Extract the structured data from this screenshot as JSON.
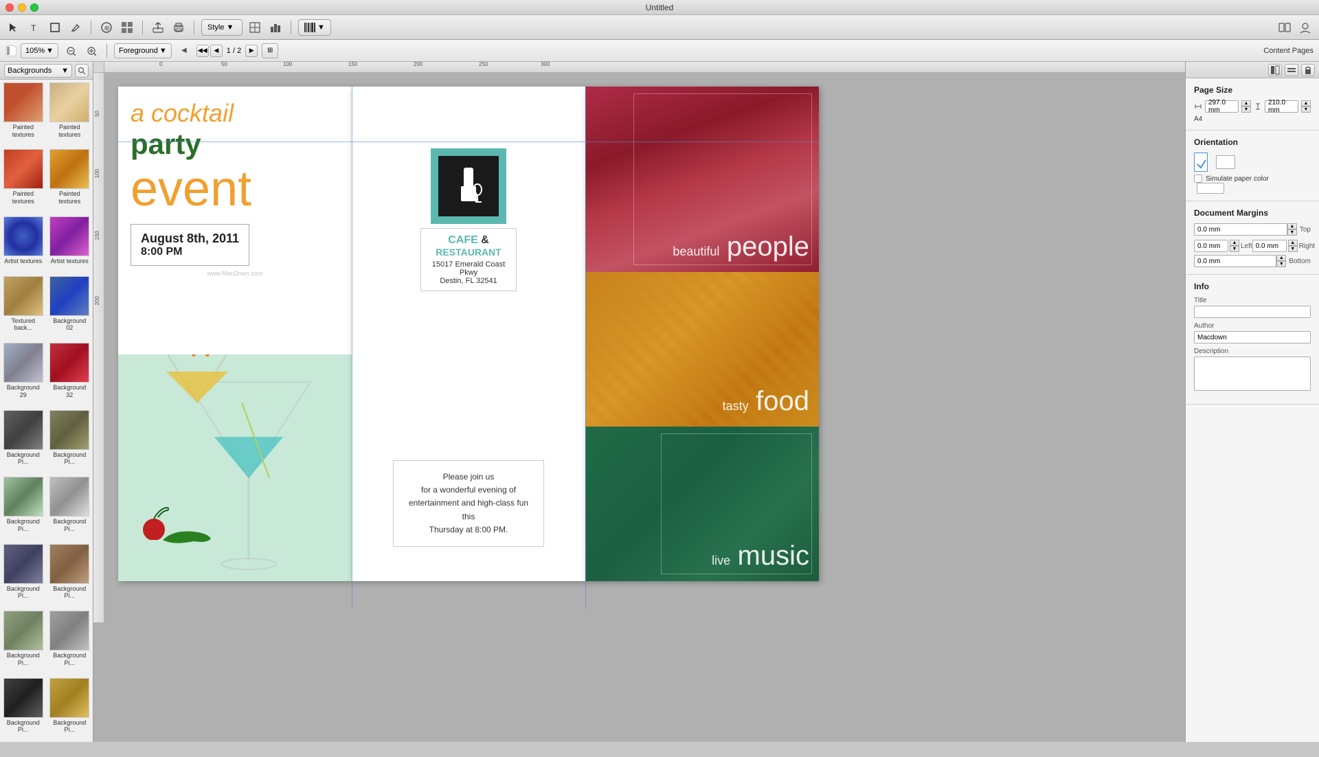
{
  "app": {
    "title": "Untitled",
    "window_controls": {
      "close": "●",
      "minimize": "●",
      "maximize": "●"
    }
  },
  "toolbar": {
    "style_label": "Style",
    "zoom_level": "105%",
    "view_mode": "Foreground",
    "page_current": "1",
    "page_total": "2",
    "content_pages_label": "Content Pages"
  },
  "left_panel": {
    "dropdown_label": "Backgrounds",
    "thumbnails": [
      {
        "label": "Painted textures",
        "style": "thumb-painted1"
      },
      {
        "label": "Painted textures",
        "style": "thumb-painted2"
      },
      {
        "label": "Painted textures",
        "style": "thumb-painted3"
      },
      {
        "label": "Painted textures",
        "style": "thumb-painted4"
      },
      {
        "label": "Artist textures",
        "style": "thumb-artist1"
      },
      {
        "label": "Artist textures",
        "style": "thumb-artist2"
      },
      {
        "label": "Textured back...",
        "style": "thumb-textured"
      },
      {
        "label": "Background 02",
        "style": "thumb-bg02"
      },
      {
        "label": "Background 29",
        "style": "thumb-bg29"
      },
      {
        "label": "Background 32",
        "style": "thumb-bg32"
      },
      {
        "label": "Background Pi...",
        "style": "thumb-bgp1"
      },
      {
        "label": "Background Pi...",
        "style": "thumb-bgp2"
      },
      {
        "label": "Background Pi...",
        "style": "thumb-bgp3"
      },
      {
        "label": "Background Pi...",
        "style": "thumb-bgp4"
      },
      {
        "label": "Background Pi...",
        "style": "thumb-bgp5"
      },
      {
        "label": "Background Pi...",
        "style": "thumb-bgp6"
      },
      {
        "label": "Background Pi...",
        "style": "thumb-bgp7"
      },
      {
        "label": "Background Pi...",
        "style": "thumb-bgp8"
      },
      {
        "label": "Background Pi...",
        "style": "thumb-bgp9"
      },
      {
        "label": "Background Pi...",
        "style": "thumb-bgp10"
      }
    ]
  },
  "page1": {
    "title_line1": "a cocktail",
    "title_line2": "party",
    "title_line3": "event",
    "date": "August 8th, 2011",
    "time": "8:00 PM",
    "watermark": "www.MacDown.com"
  },
  "page2": {
    "cafe_label": "CAFE",
    "and_label": "&",
    "restaurant_label": "RESTAURANT",
    "address_line1": "15017 Emerald Coast Pkwy",
    "address_line2": "Destin, FL 32541",
    "invitation": "Please join us\nfor a wonderful evening of\nentertainment and high-class fun this\nThursday at 8:00 PM."
  },
  "page3": {
    "section1": {
      "small_text": "beautiful",
      "big_text": "people"
    },
    "section2": {
      "small_text": "tasty",
      "big_text": "food"
    },
    "section3": {
      "small_text": "live",
      "big_text": "music"
    }
  },
  "right_panel": {
    "page_size_title": "Page Size",
    "width_label": "Width",
    "width_value": "297.0 mm",
    "height_label": "Height",
    "height_value": "210.0 mm",
    "paper_label": "A4",
    "orientation_title": "Orientation",
    "simulate_label": "Simulate paper color",
    "margins_title": "Document Margins",
    "margin_top": "0.0 mm",
    "margin_left": "0.0 mm",
    "margin_right": "0.0 mm",
    "margin_bottom": "0.0 mm",
    "margin_top_label": "Top",
    "margin_left_label": "Left",
    "margin_right_label": "Right",
    "margin_bottom_label": "Bottom",
    "info_title": "Info",
    "title_field_label": "Title",
    "author_label": "Author",
    "author_value": "Macdown",
    "description_label": "Description"
  },
  "ruler": {
    "marks": [
      "0",
      "50",
      "100",
      "150",
      "200",
      "250",
      "300"
    ],
    "left_marks": [
      "50",
      "100",
      "150",
      "200"
    ]
  }
}
